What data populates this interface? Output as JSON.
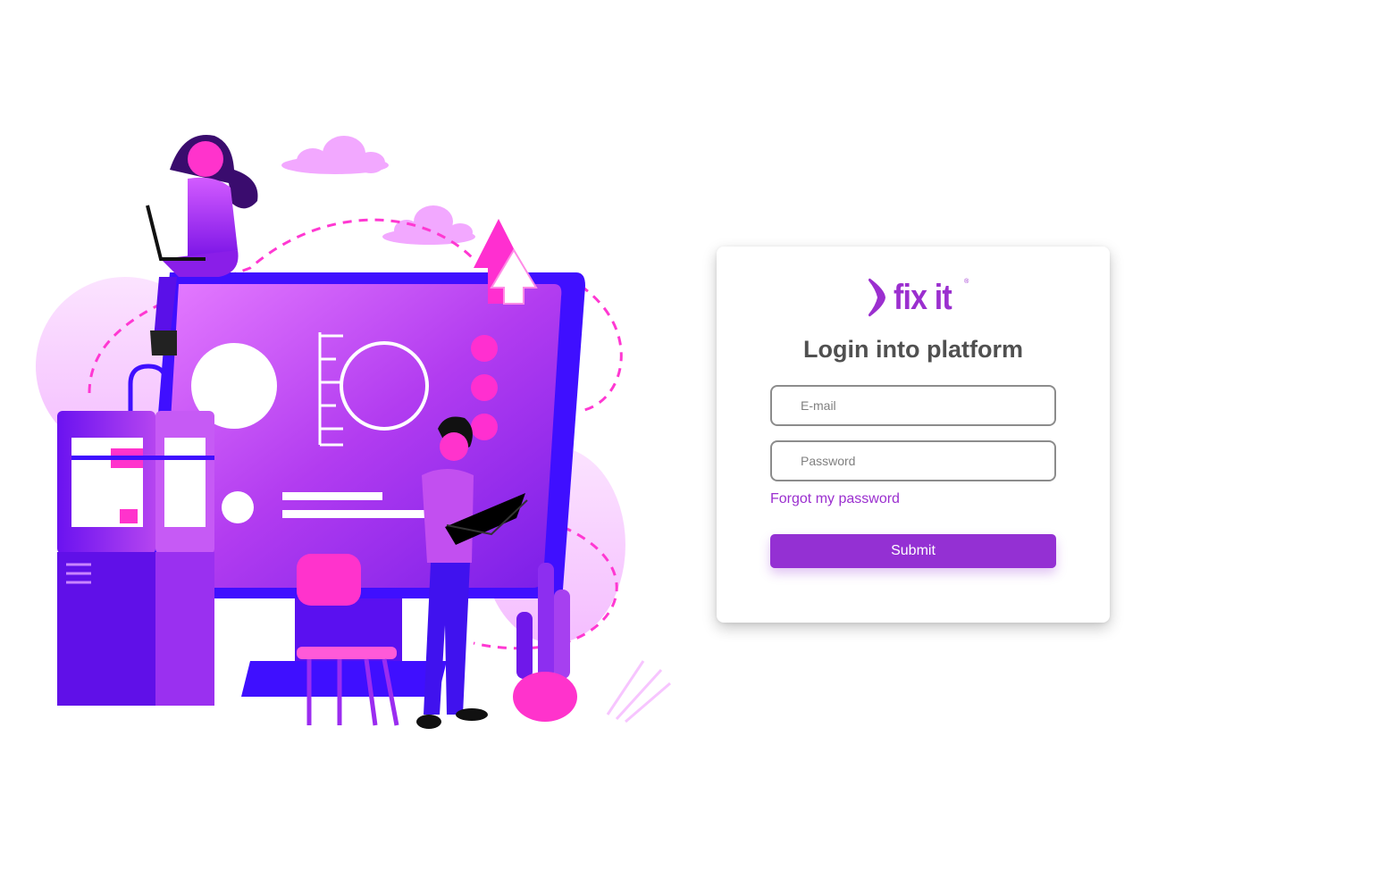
{
  "brand": {
    "name": "fix it",
    "trademark": "®",
    "logo_icon": "chevron-swoosh-icon",
    "color": "#9b2fcf"
  },
  "login": {
    "title": "Login into platform",
    "email_placeholder": "E-mail",
    "email_value": "",
    "password_placeholder": "Password",
    "password_value": "",
    "forgot_label": "Forgot my password",
    "submit_label": "Submit"
  },
  "colors": {
    "accent": "#9430d3",
    "title_text": "#505050",
    "field_border": "#8c8c8c",
    "illustration_primary": "#8a2be2",
    "illustration_blue": "#3f0fff",
    "illustration_pink": "#ff33cc"
  }
}
